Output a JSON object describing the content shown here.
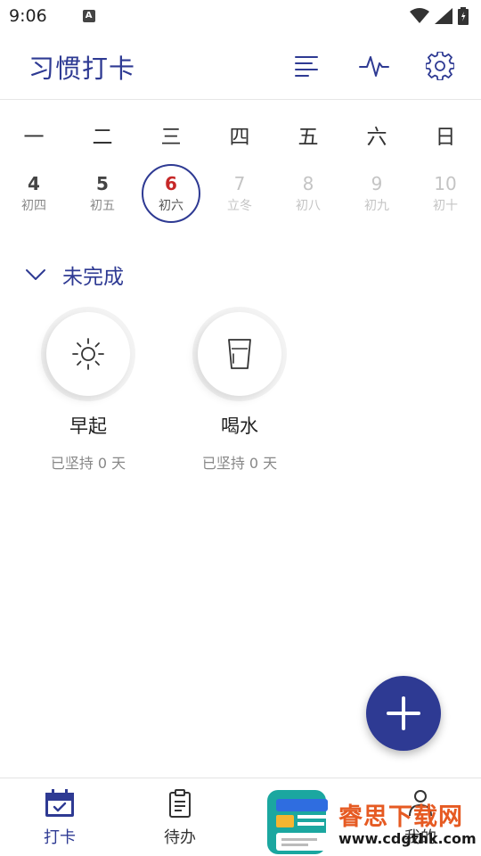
{
  "status_bar": {
    "time": "9:06",
    "notification_icon": "A"
  },
  "app_bar": {
    "title": "习惯打卡",
    "actions": [
      "sort-icon",
      "pulse-icon",
      "settings-icon"
    ]
  },
  "week": {
    "weekdays": [
      "一",
      "二",
      "三",
      "四",
      "五",
      "六",
      "日"
    ],
    "dates": [
      {
        "num": "4",
        "lunar": "初四",
        "state": "past"
      },
      {
        "num": "5",
        "lunar": "初五",
        "state": "past"
      },
      {
        "num": "6",
        "lunar": "初六",
        "state": "today"
      },
      {
        "num": "7",
        "lunar": "立冬",
        "state": "future"
      },
      {
        "num": "8",
        "lunar": "初八",
        "state": "future"
      },
      {
        "num": "9",
        "lunar": "初九",
        "state": "future"
      },
      {
        "num": "10",
        "lunar": "初十",
        "state": "future"
      }
    ]
  },
  "section": {
    "title": "未完成"
  },
  "habits": [
    {
      "name": "早起",
      "streak": "已坚持 0 天",
      "icon": "sun-icon"
    },
    {
      "name": "喝水",
      "streak": "已坚持 0 天",
      "icon": "cup-icon"
    }
  ],
  "bottom_nav": {
    "items": [
      {
        "label": "打卡",
        "icon": "calendar-check-icon",
        "active": true
      },
      {
        "label": "待办",
        "icon": "clipboard-icon",
        "active": false
      },
      {
        "label": "",
        "icon": "stats-icon",
        "active": false
      },
      {
        "label": "我的",
        "icon": "user-icon",
        "active": false
      }
    ]
  },
  "watermark": {
    "text": "睿思下载网",
    "url": "www.cdgthk.com"
  },
  "colors": {
    "accent": "#2e3a93",
    "today_red": "#c62828"
  }
}
